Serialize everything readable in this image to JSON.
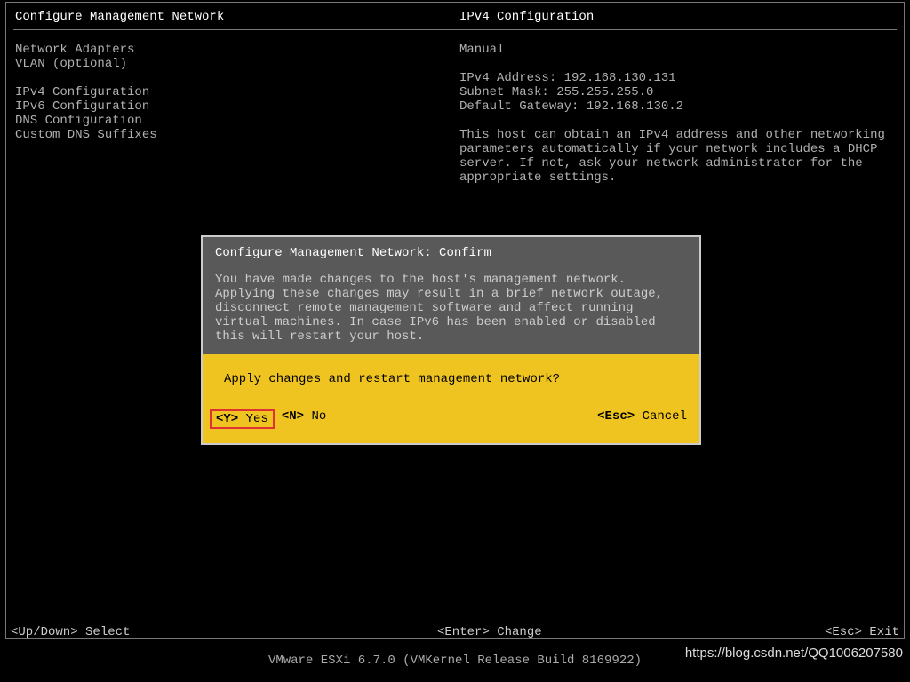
{
  "header": {
    "left_title": "Configure Management Network",
    "right_title": "IPv4 Configuration"
  },
  "menu": {
    "items": [
      "Network Adapters",
      "VLAN (optional)",
      "",
      "IPv4 Configuration",
      "IPv6 Configuration",
      "DNS Configuration",
      "Custom DNS Suffixes"
    ]
  },
  "detail": {
    "mode": "Manual",
    "ipv4_label": "IPv4 Address:",
    "ipv4_value": "192.168.130.131",
    "mask_label": "Subnet Mask:",
    "mask_value": "255.255.255.0",
    "gw_label": "Default Gateway:",
    "gw_value": "192.168.130.2",
    "description": "This host can obtain an IPv4 address and other networking parameters automatically if your network includes a DHCP server. If not, ask your network administrator for the appropriate settings."
  },
  "dialog": {
    "title": "Configure Management Network: Confirm",
    "body": "You have made changes to the host's management network.\nApplying these changes may result in a brief network outage, disconnect remote management software and affect running virtual machines. In case IPv6 has been enabled or disabled this will restart your host.",
    "question": "Apply changes and restart management network?",
    "actions": {
      "yes_key": "<Y>",
      "yes_label": "Yes",
      "no_key": "<N>",
      "no_label": "No",
      "cancel_key": "<Esc>",
      "cancel_label": "Cancel"
    }
  },
  "hints": {
    "left": "<Up/Down> Select",
    "center": "<Enter> Change",
    "right": "<Esc> Exit"
  },
  "footer": {
    "text": "VMware ESXi 6.7.0 (VMKernel Release Build 8169922)"
  },
  "watermark": "https://blog.csdn.net/QQ1006207580"
}
